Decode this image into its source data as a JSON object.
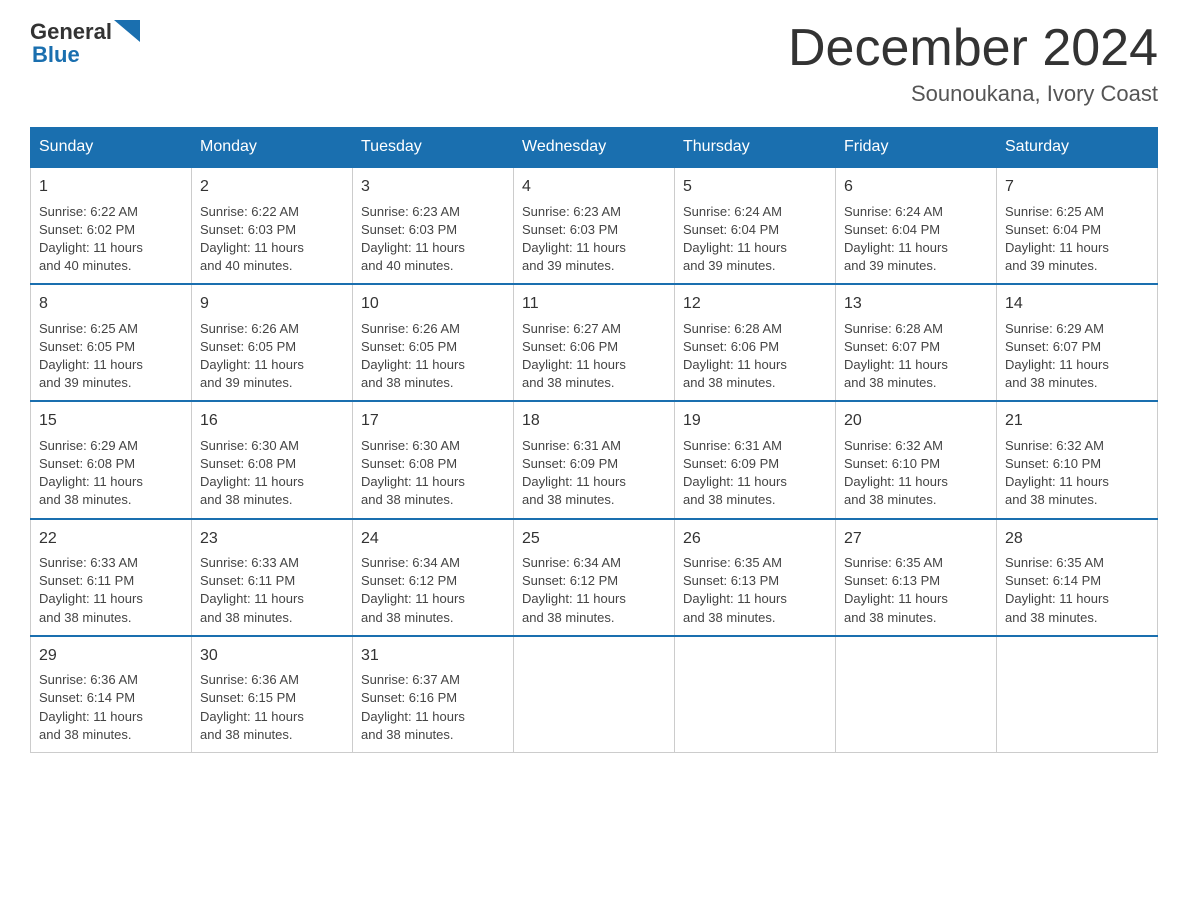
{
  "logo": {
    "text_general": "General",
    "text_blue": "Blue"
  },
  "title": "December 2024",
  "location": "Sounoukana, Ivory Coast",
  "days_of_week": [
    "Sunday",
    "Monday",
    "Tuesday",
    "Wednesday",
    "Thursday",
    "Friday",
    "Saturday"
  ],
  "weeks": [
    [
      {
        "day": "1",
        "info": "Sunrise: 6:22 AM\nSunset: 6:02 PM\nDaylight: 11 hours\nand 40 minutes."
      },
      {
        "day": "2",
        "info": "Sunrise: 6:22 AM\nSunset: 6:03 PM\nDaylight: 11 hours\nand 40 minutes."
      },
      {
        "day": "3",
        "info": "Sunrise: 6:23 AM\nSunset: 6:03 PM\nDaylight: 11 hours\nand 40 minutes."
      },
      {
        "day": "4",
        "info": "Sunrise: 6:23 AM\nSunset: 6:03 PM\nDaylight: 11 hours\nand 39 minutes."
      },
      {
        "day": "5",
        "info": "Sunrise: 6:24 AM\nSunset: 6:04 PM\nDaylight: 11 hours\nand 39 minutes."
      },
      {
        "day": "6",
        "info": "Sunrise: 6:24 AM\nSunset: 6:04 PM\nDaylight: 11 hours\nand 39 minutes."
      },
      {
        "day": "7",
        "info": "Sunrise: 6:25 AM\nSunset: 6:04 PM\nDaylight: 11 hours\nand 39 minutes."
      }
    ],
    [
      {
        "day": "8",
        "info": "Sunrise: 6:25 AM\nSunset: 6:05 PM\nDaylight: 11 hours\nand 39 minutes."
      },
      {
        "day": "9",
        "info": "Sunrise: 6:26 AM\nSunset: 6:05 PM\nDaylight: 11 hours\nand 39 minutes."
      },
      {
        "day": "10",
        "info": "Sunrise: 6:26 AM\nSunset: 6:05 PM\nDaylight: 11 hours\nand 38 minutes."
      },
      {
        "day": "11",
        "info": "Sunrise: 6:27 AM\nSunset: 6:06 PM\nDaylight: 11 hours\nand 38 minutes."
      },
      {
        "day": "12",
        "info": "Sunrise: 6:28 AM\nSunset: 6:06 PM\nDaylight: 11 hours\nand 38 minutes."
      },
      {
        "day": "13",
        "info": "Sunrise: 6:28 AM\nSunset: 6:07 PM\nDaylight: 11 hours\nand 38 minutes."
      },
      {
        "day": "14",
        "info": "Sunrise: 6:29 AM\nSunset: 6:07 PM\nDaylight: 11 hours\nand 38 minutes."
      }
    ],
    [
      {
        "day": "15",
        "info": "Sunrise: 6:29 AM\nSunset: 6:08 PM\nDaylight: 11 hours\nand 38 minutes."
      },
      {
        "day": "16",
        "info": "Sunrise: 6:30 AM\nSunset: 6:08 PM\nDaylight: 11 hours\nand 38 minutes."
      },
      {
        "day": "17",
        "info": "Sunrise: 6:30 AM\nSunset: 6:08 PM\nDaylight: 11 hours\nand 38 minutes."
      },
      {
        "day": "18",
        "info": "Sunrise: 6:31 AM\nSunset: 6:09 PM\nDaylight: 11 hours\nand 38 minutes."
      },
      {
        "day": "19",
        "info": "Sunrise: 6:31 AM\nSunset: 6:09 PM\nDaylight: 11 hours\nand 38 minutes."
      },
      {
        "day": "20",
        "info": "Sunrise: 6:32 AM\nSunset: 6:10 PM\nDaylight: 11 hours\nand 38 minutes."
      },
      {
        "day": "21",
        "info": "Sunrise: 6:32 AM\nSunset: 6:10 PM\nDaylight: 11 hours\nand 38 minutes."
      }
    ],
    [
      {
        "day": "22",
        "info": "Sunrise: 6:33 AM\nSunset: 6:11 PM\nDaylight: 11 hours\nand 38 minutes."
      },
      {
        "day": "23",
        "info": "Sunrise: 6:33 AM\nSunset: 6:11 PM\nDaylight: 11 hours\nand 38 minutes."
      },
      {
        "day": "24",
        "info": "Sunrise: 6:34 AM\nSunset: 6:12 PM\nDaylight: 11 hours\nand 38 minutes."
      },
      {
        "day": "25",
        "info": "Sunrise: 6:34 AM\nSunset: 6:12 PM\nDaylight: 11 hours\nand 38 minutes."
      },
      {
        "day": "26",
        "info": "Sunrise: 6:35 AM\nSunset: 6:13 PM\nDaylight: 11 hours\nand 38 minutes."
      },
      {
        "day": "27",
        "info": "Sunrise: 6:35 AM\nSunset: 6:13 PM\nDaylight: 11 hours\nand 38 minutes."
      },
      {
        "day": "28",
        "info": "Sunrise: 6:35 AM\nSunset: 6:14 PM\nDaylight: 11 hours\nand 38 minutes."
      }
    ],
    [
      {
        "day": "29",
        "info": "Sunrise: 6:36 AM\nSunset: 6:14 PM\nDaylight: 11 hours\nand 38 minutes."
      },
      {
        "day": "30",
        "info": "Sunrise: 6:36 AM\nSunset: 6:15 PM\nDaylight: 11 hours\nand 38 minutes."
      },
      {
        "day": "31",
        "info": "Sunrise: 6:37 AM\nSunset: 6:16 PM\nDaylight: 11 hours\nand 38 minutes."
      },
      {
        "day": "",
        "info": ""
      },
      {
        "day": "",
        "info": ""
      },
      {
        "day": "",
        "info": ""
      },
      {
        "day": "",
        "info": ""
      }
    ]
  ]
}
